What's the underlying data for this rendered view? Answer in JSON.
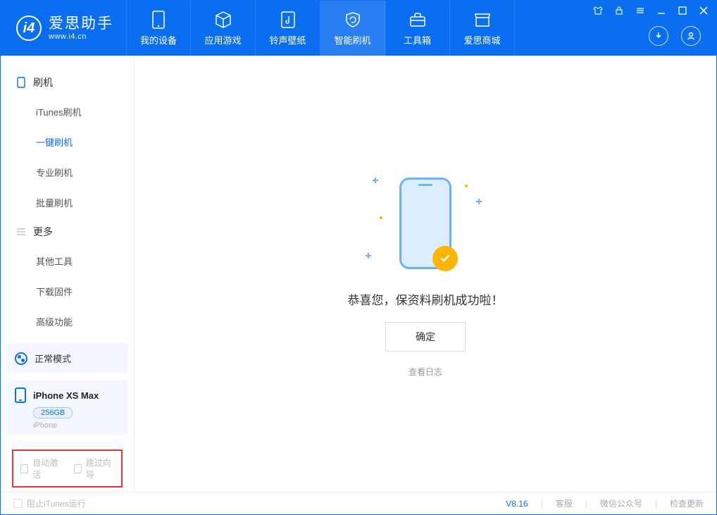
{
  "app": {
    "title": "爱思助手",
    "subtitle": "www.i4.cn"
  },
  "nav": [
    {
      "label": "我的设备"
    },
    {
      "label": "应用游戏"
    },
    {
      "label": "铃声壁纸"
    },
    {
      "label": "智能刷机"
    },
    {
      "label": "工具箱"
    },
    {
      "label": "爱思商城"
    }
  ],
  "sidebar": {
    "group1": {
      "title": "刷机",
      "items": [
        "iTunes刷机",
        "一键刷机",
        "专业刷机",
        "批量刷机"
      ]
    },
    "group2": {
      "title": "更多",
      "items": [
        "其他工具",
        "下载固件",
        "高级功能"
      ]
    }
  },
  "mode": {
    "label": "正常模式"
  },
  "device": {
    "name": "iPhone XS Max",
    "capacity": "256GB",
    "type": "iPhone"
  },
  "checks": {
    "auto_activate": "自动激活",
    "skip_guide": "跳过向导"
  },
  "content": {
    "message": "恭喜您，保资料刷机成功啦！",
    "ok": "确定",
    "log": "查看日志"
  },
  "footer": {
    "block_itunes": "阻止iTunes运行",
    "version": "V8.16",
    "support": "客服",
    "wechat": "微信公众号",
    "update": "检查更新"
  }
}
